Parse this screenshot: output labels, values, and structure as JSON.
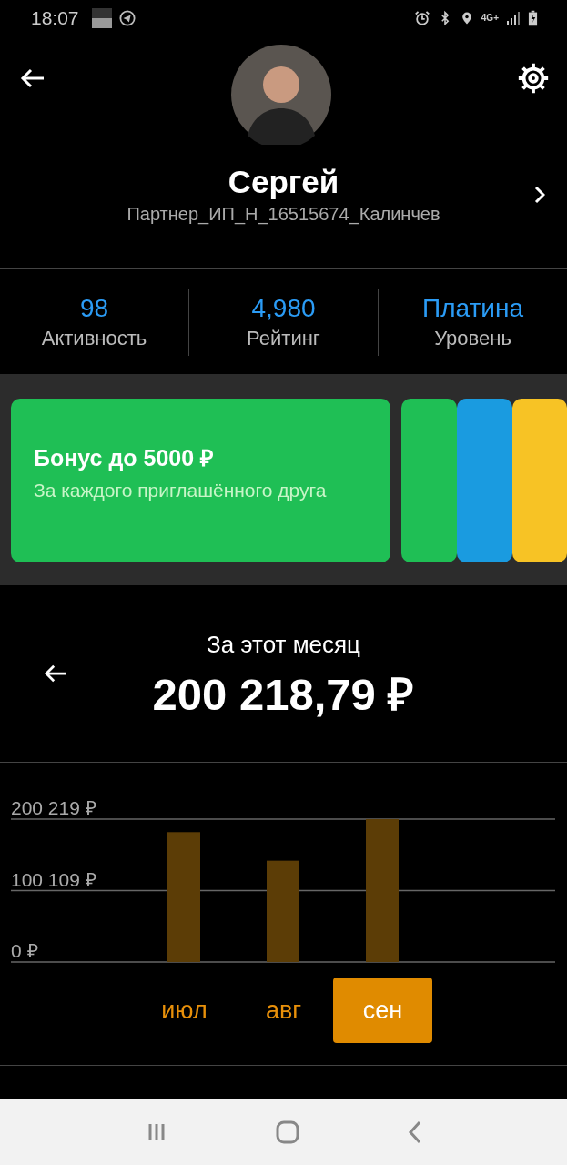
{
  "status_bar": {
    "time": "18:07",
    "network": "4G+"
  },
  "profile": {
    "name": "Сергей",
    "subtitle": "Партнер_ИП_Н_16515674_Калинчев"
  },
  "stats": [
    {
      "value": "98",
      "label": "Активность"
    },
    {
      "value": "4,980",
      "label": "Рейтинг"
    },
    {
      "value": "Платина",
      "label": "Уровень"
    }
  ],
  "cards": [
    {
      "title": "Бонус до 5000 ₽",
      "text": "За каждого приглашённого друга",
      "color": "#1fbf55"
    },
    {
      "color": "#1fbf55"
    },
    {
      "color": "#1a9be0"
    },
    {
      "color": "#f7c325"
    }
  ],
  "earnings": {
    "period": "За этот месяц",
    "amount": "200 218,79 ₽"
  },
  "chart_data": {
    "type": "bar",
    "categories": [
      "июл",
      "авг",
      "сен"
    ],
    "values": [
      182000,
      142000,
      200219
    ],
    "ylim": [
      0,
      200219
    ],
    "yticks": [
      {
        "value": 0,
        "label": "0 ₽"
      },
      {
        "value": 100109,
        "label": "100 109 ₽"
      },
      {
        "value": 200219,
        "label": "200 219 ₽"
      }
    ]
  },
  "month_tabs": [
    {
      "selected": false
    },
    {
      "selected": false
    },
    {
      "selected": true
    }
  ]
}
